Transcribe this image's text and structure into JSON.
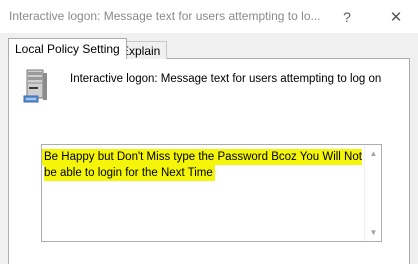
{
  "window": {
    "title": "Interactive logon: Message text for users attempting to lo...",
    "help_glyph": "?",
    "close_glyph": "✕"
  },
  "tabs": [
    {
      "label": "Local Policy Setting",
      "active": true
    },
    {
      "label": "Explain",
      "active": false
    }
  ],
  "policy": {
    "icon": "server-computer-icon",
    "name": "Interactive logon: Message text for users attempting to log on"
  },
  "message": {
    "value": "Be Happy but Don't Miss type the Password Bcoz You Will Not be able to login for the Next Time",
    "highlight_color": "#f5f50a"
  },
  "scrollbar": {
    "up_glyph": "▲",
    "down_glyph": "▼"
  }
}
